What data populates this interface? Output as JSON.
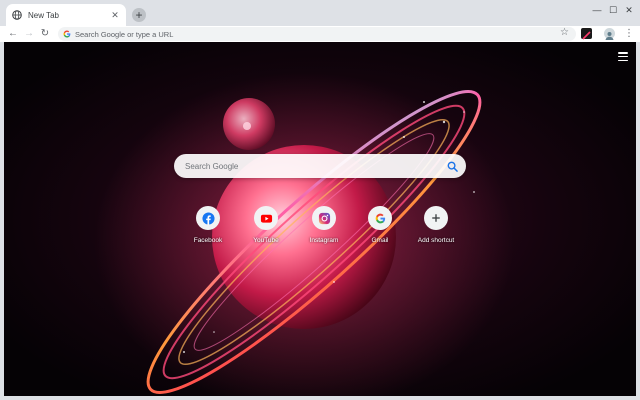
{
  "browser": {
    "tab": {
      "title": "New Tab",
      "close_glyph": "✕",
      "icon": "globe-icon"
    },
    "new_tab_glyph": "+",
    "window_controls": {
      "minimize": "—",
      "maximize": "☐",
      "close": "✕"
    },
    "toolbar": {
      "back_glyph": "←",
      "forward_glyph": "→",
      "reload_glyph": "↻",
      "omnibox_placeholder": "Search Google or type a URL",
      "star_glyph": "☆",
      "menu_glyph": "⋮"
    }
  },
  "newtab": {
    "background_theme": "glowing ringed planet on dark space",
    "search_placeholder": "Search Google",
    "shortcuts": [
      {
        "label": "Facebook",
        "icon": "facebook-icon",
        "color": "#1877f2"
      },
      {
        "label": "YouTube",
        "icon": "youtube-icon",
        "color": "#ff0000"
      },
      {
        "label": "Instagram",
        "icon": "instagram-icon",
        "color": "#c13584"
      },
      {
        "label": "Gmail",
        "icon": "google-icon",
        "color": "#4285f4"
      },
      {
        "label": "Add shortcut",
        "icon": "plus-icon",
        "color": "#3c4043"
      }
    ]
  },
  "colors": {
    "frame": "#dee1e6",
    "omnibox_bg": "#f1f3f4",
    "accent_blue": "#1a73e8",
    "planet_glow": "#ff4f7a"
  }
}
